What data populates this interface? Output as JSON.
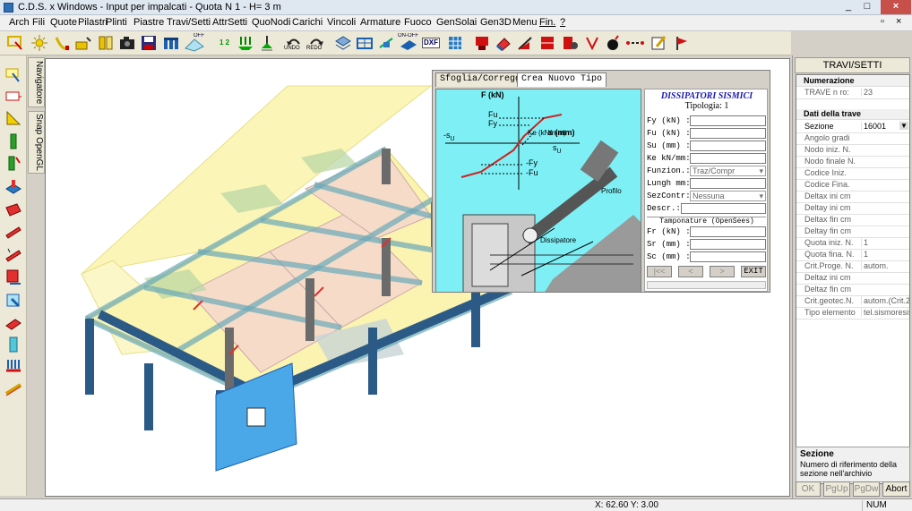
{
  "window": {
    "title": "C.D.S. x Windows - Input per impalcati - Quota N 1 - H= 3 m",
    "minimize": "_",
    "maximize": "□",
    "close": "×"
  },
  "menu": {
    "items": [
      "Arch",
      "Fili",
      "Quote",
      "Pilastri",
      "Plinti",
      "Piastre",
      "Travi/Setti",
      "AttrSetti",
      "QuoNodi",
      "Carichi",
      "Vincoli",
      "Armature",
      "Fuoco",
      "GenSolai",
      "Gen3D",
      "Menu",
      "Fin.",
      "?"
    ],
    "mdi_restore": "▫",
    "mdi_close": "×"
  },
  "toolbar": {
    "undo_label": "UNDO",
    "redo_label": "REDO",
    "off_label": "OFF",
    "onoff_label": "ON-OFF",
    "dxf_label": "DXF",
    "hf_label": "HF",
    "b12_label": "1 2"
  },
  "side_tabs": {
    "navigator": "Navigatore",
    "snap": "Snap OpenGL"
  },
  "dialog": {
    "tabs": [
      "Sfoglia/Correggie",
      "Crea Nuovo Tipo"
    ],
    "diagram": {
      "f_axis": "F (kN)",
      "s_axis": "s (mm)",
      "fu": "Fu",
      "fy": "Fy",
      "neg_fy": "-Fy",
      "neg_fu": "-Fu",
      "su": "s",
      "su_sub": "U",
      "neg_su": "-s",
      "neg_su_sub": "U",
      "ke": "Ke (kN/mm)",
      "profilo": "Profilo",
      "dissipatore": "Dissipatore"
    },
    "form": {
      "header": "DISSIPATORI SISMICI",
      "subheader": "Tipologia: 1",
      "fy": "Fy  (kN) :",
      "fu": "Fu  (kN) :",
      "su": "Su  (mm) :",
      "ke": "Ke kN/mm:",
      "funzion": "Funzion.:",
      "funzion_value": "Traz/Compr",
      "lungh": "Lungh mm:",
      "sezcontr": "SezContr:",
      "sezcontr_value": "Nessuna",
      "descr": "Descr.:",
      "tamponature": "Tamponature (OpenSees)",
      "fr": "Fr  (kN) :",
      "sr": "Sr  (mm) :",
      "sc": "Sc  (mm) :",
      "first_btn": "|<<",
      "prev_btn": "<",
      "next_btn": ">",
      "exit_btn": "EXIT"
    }
  },
  "right_panel": {
    "title": "TRAVI/SETTI",
    "section1": "Numerazione",
    "trave_label": "TRAVE n ro:",
    "trave_value": "23",
    "section2": "Dati della trave",
    "rows": [
      {
        "label": "Sezione",
        "value": "16001"
      },
      {
        "label": "Angolo  gradi",
        "value": ""
      },
      {
        "label": "Nodo iniz. N.",
        "value": ""
      },
      {
        "label": "Nodo finale N.",
        "value": ""
      },
      {
        "label": "Codice Iniz.",
        "value": ""
      },
      {
        "label": "Codice Fina.",
        "value": ""
      },
      {
        "label": "Deltax ini cm",
        "value": ""
      },
      {
        "label": "Deltay ini cm",
        "value": ""
      },
      {
        "label": "Deltax fin cm",
        "value": ""
      },
      {
        "label": "Deltay fin cm",
        "value": ""
      },
      {
        "label": "Quota iniz. N.",
        "value": "1"
      },
      {
        "label": "Quota fina. N.",
        "value": "1"
      },
      {
        "label": "Crit.Proge. N.",
        "value": "autom."
      },
      {
        "label": "Deltaz ini cm",
        "value": ""
      },
      {
        "label": "Deltaz fin cm",
        "value": ""
      },
      {
        "label": "Crit.geotec.N.",
        "value": "autom.(Crit.2)"
      },
      {
        "label": "Tipo elemento",
        "value": "tel.sismoresist"
      }
    ],
    "desc_title": "Sezione",
    "desc_text": "Numero di riferimento della sezione nell'archivio",
    "btn_ok": "OK",
    "btn_pgup": "PgUp",
    "btn_pgdw": "PgDw",
    "btn_abort": "Abort"
  },
  "status": {
    "coords": "X: 62.60  Y: 3.00",
    "num": "NUM"
  }
}
